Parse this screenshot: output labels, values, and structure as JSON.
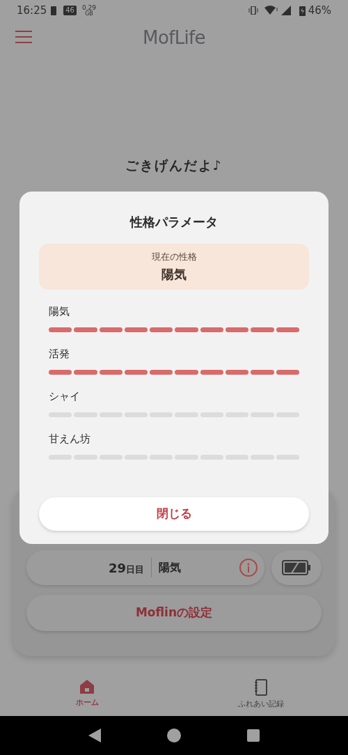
{
  "status_bar": {
    "time": "16:25",
    "network_badge": "46",
    "data_amount": "0.29",
    "data_unit": "GB",
    "battery": "46%"
  },
  "header": {
    "title": "MofLife"
  },
  "greeting": "ごきげんだよ♪",
  "status_card": {
    "day_number": "29",
    "day_unit": "日目",
    "personality": "陽気",
    "settings_button": "Moflinの設定"
  },
  "bottom_nav": [
    {
      "label": "ホーム",
      "kind": "home",
      "selected": true
    },
    {
      "label": "ふれあい記録",
      "kind": "notebook",
      "selected": false
    }
  ],
  "dialog": {
    "title": "性格パラメータ",
    "current_label": "現在の性格",
    "current_value": "陽気",
    "traits": [
      {
        "name": "陽気",
        "stars": 10
      },
      {
        "name": "活発",
        "stars": 10
      },
      {
        "name": "シャイ",
        "stars": 0
      },
      {
        "name": "甘えん坊",
        "stars": 0
      }
    ],
    "close_button": "閉じる"
  }
}
